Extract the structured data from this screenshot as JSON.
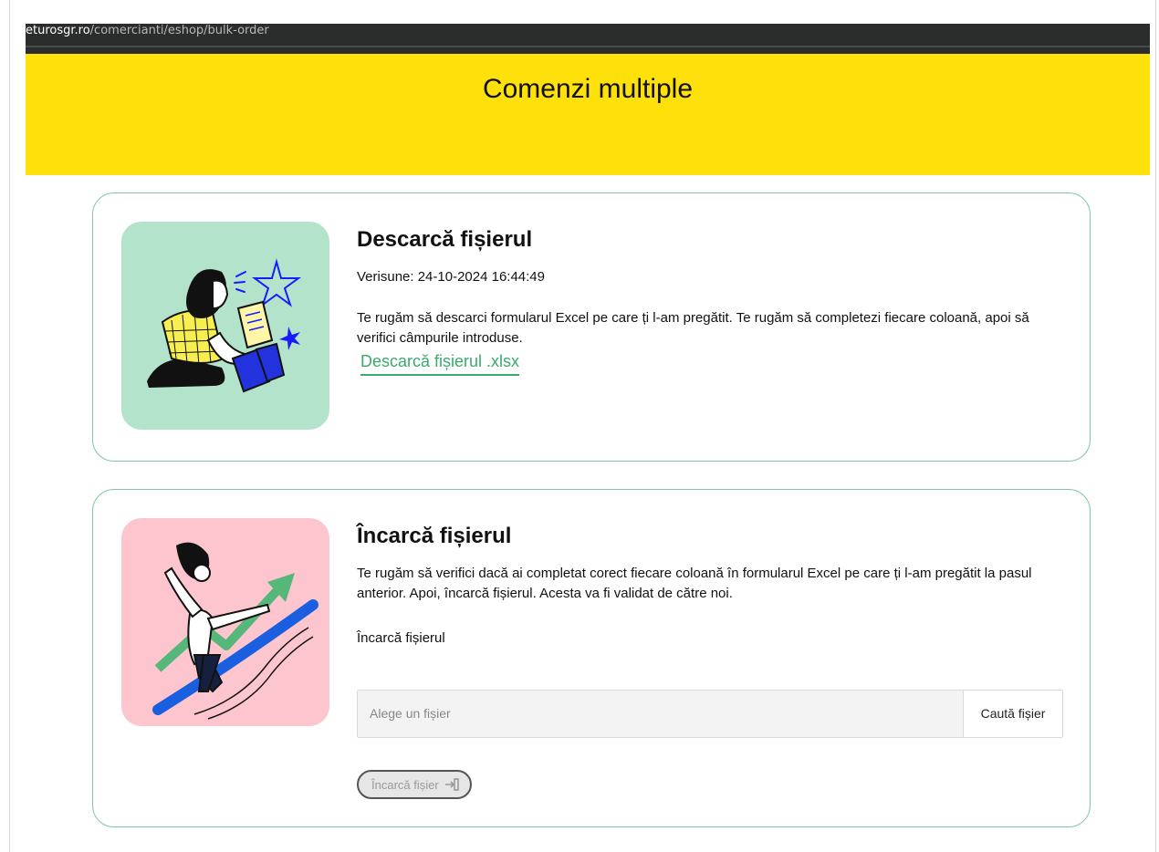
{
  "browser": {
    "url_host": "eturosgr.ro",
    "url_path": "/comercianti/eshop/bulk-order"
  },
  "banner": {
    "title": "Comenzi multiple"
  },
  "download_card": {
    "title": "Descarcă fișierul",
    "version": "Verisune: 24-10-2024 16:44:49",
    "description": "Te rugăm să descarci formularul Excel pe care ți l-am pregătit. Te rugăm să completezi fiecare coloană, apoi să verifici câmpurile introduse.",
    "link_label": "Descarcă fișierul .xlsx",
    "illustration_bg": "#b3e3cb"
  },
  "upload_card": {
    "title": "Încarcă fișierul",
    "description": "Te rugăm să verifici dacă ai completat corect fiecare coloană în formularul Excel pe care ți l-am pregătit la pasul anterior. Apoi, încarcă fișierul. Acesta va fi validat de către noi.",
    "field_label": "Încarcă fișierul",
    "file_placeholder": "Alege un fișier",
    "browse_label": "Caută fișier",
    "submit_label": "Încarcă fișier",
    "submit_icon": "upload-arrow-icon",
    "illustration_bg": "#fdc6cf"
  },
  "colors": {
    "banner": "#fee00b",
    "accent_green": "#3aaa6b",
    "card_border": "#7dc7a0"
  }
}
